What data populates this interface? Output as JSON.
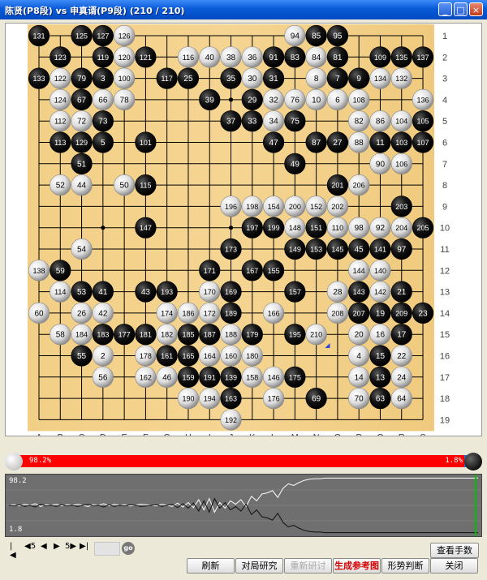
{
  "window": {
    "title": "陈贤(P8段) vs 申真谞(P9段) (210 / 210)",
    "controls": [
      "minimize",
      "maximize",
      "close"
    ]
  },
  "board": {
    "size": 19,
    "col_labels": [
      "A",
      "B",
      "C",
      "D",
      "E",
      "F",
      "G",
      "H",
      "I",
      "J",
      "K",
      "L",
      "M",
      "N",
      "O",
      "P",
      "Q",
      "R",
      "S"
    ],
    "row_labels": [
      "1",
      "2",
      "3",
      "4",
      "5",
      "6",
      "7",
      "8",
      "9",
      "10",
      "11",
      "12",
      "13",
      "14",
      "15",
      "16",
      "17",
      "18",
      "19"
    ],
    "last_move": 210,
    "stones": [
      {
        "n": 131,
        "c": "B",
        "col": "A",
        "row": 1
      },
      {
        "n": 125,
        "c": "B",
        "col": "C",
        "row": 1
      },
      {
        "n": 127,
        "c": "B",
        "col": "D",
        "row": 1
      },
      {
        "n": 126,
        "c": "W",
        "col": "E",
        "row": 1
      },
      {
        "n": 94,
        "c": "W",
        "col": "M",
        "row": 1
      },
      {
        "n": 85,
        "c": "B",
        "col": "N",
        "row": 1
      },
      {
        "n": 95,
        "c": "B",
        "col": "O",
        "row": 1
      },
      {
        "n": 123,
        "c": "B",
        "col": "B",
        "row": 2
      },
      {
        "n": 119,
        "c": "B",
        "col": "D",
        "row": 2
      },
      {
        "n": 120,
        "c": "W",
        "col": "E",
        "row": 2
      },
      {
        "n": 121,
        "c": "B",
        "col": "F",
        "row": 2
      },
      {
        "n": 116,
        "c": "W",
        "col": "H",
        "row": 2
      },
      {
        "n": 40,
        "c": "W",
        "col": "I",
        "row": 2
      },
      {
        "n": 38,
        "c": "W",
        "col": "J",
        "row": 2
      },
      {
        "n": 36,
        "c": "W",
        "col": "K",
        "row": 2
      },
      {
        "n": 91,
        "c": "B",
        "col": "L",
        "row": 2
      },
      {
        "n": 83,
        "c": "B",
        "col": "M",
        "row": 2
      },
      {
        "n": 84,
        "c": "W",
        "col": "N",
        "row": 2
      },
      {
        "n": 81,
        "c": "B",
        "col": "O",
        "row": 2
      },
      {
        "n": 109,
        "c": "B",
        "col": "Q",
        "row": 2
      },
      {
        "n": 135,
        "c": "B",
        "col": "R",
        "row": 2
      },
      {
        "n": 137,
        "c": "B",
        "col": "S",
        "row": 2
      },
      {
        "n": 133,
        "c": "B",
        "col": "A",
        "row": 3
      },
      {
        "n": 122,
        "c": "W",
        "col": "B",
        "row": 3
      },
      {
        "n": 79,
        "c": "B",
        "col": "C",
        "row": 3
      },
      {
        "n": 3,
        "c": "B",
        "col": "D",
        "row": 3
      },
      {
        "n": 100,
        "c": "W",
        "col": "E",
        "row": 3
      },
      {
        "n": 117,
        "c": "B",
        "col": "G",
        "row": 3
      },
      {
        "n": 25,
        "c": "B",
        "col": "H",
        "row": 3
      },
      {
        "n": 35,
        "c": "B",
        "col": "J",
        "row": 3
      },
      {
        "n": 30,
        "c": "W",
        "col": "K",
        "row": 3
      },
      {
        "n": 31,
        "c": "B",
        "col": "L",
        "row": 3
      },
      {
        "n": 8,
        "c": "W",
        "col": "N",
        "row": 3
      },
      {
        "n": 7,
        "c": "B",
        "col": "O",
        "row": 3
      },
      {
        "n": 9,
        "c": "B",
        "col": "P",
        "row": 3
      },
      {
        "n": 134,
        "c": "W",
        "col": "Q",
        "row": 3
      },
      {
        "n": 132,
        "c": "W",
        "col": "R",
        "row": 3
      },
      {
        "n": 124,
        "c": "W",
        "col": "B",
        "row": 4
      },
      {
        "n": 67,
        "c": "B",
        "col": "C",
        "row": 4
      },
      {
        "n": 66,
        "c": "W",
        "col": "D",
        "row": 4
      },
      {
        "n": 78,
        "c": "W",
        "col": "E",
        "row": 4
      },
      {
        "n": 39,
        "c": "B",
        "col": "I",
        "row": 4
      },
      {
        "n": 29,
        "c": "B",
        "col": "K",
        "row": 4
      },
      {
        "n": 32,
        "c": "W",
        "col": "L",
        "row": 4
      },
      {
        "n": 76,
        "c": "W",
        "col": "M",
        "row": 4
      },
      {
        "n": 10,
        "c": "W",
        "col": "N",
        "row": 4
      },
      {
        "n": 6,
        "c": "W",
        "col": "O",
        "row": 4
      },
      {
        "n": 108,
        "c": "W",
        "col": "P",
        "row": 4
      },
      {
        "n": 136,
        "c": "W",
        "col": "S",
        "row": 4
      },
      {
        "n": 112,
        "c": "W",
        "col": "B",
        "row": 5
      },
      {
        "n": 72,
        "c": "W",
        "col": "C",
        "row": 5
      },
      {
        "n": 73,
        "c": "B",
        "col": "D",
        "row": 5
      },
      {
        "n": 37,
        "c": "B",
        "col": "J",
        "row": 5
      },
      {
        "n": 33,
        "c": "B",
        "col": "K",
        "row": 5
      },
      {
        "n": 34,
        "c": "W",
        "col": "L",
        "row": 5
      },
      {
        "n": 75,
        "c": "B",
        "col": "M",
        "row": 5
      },
      {
        "n": 82,
        "c": "W",
        "col": "P",
        "row": 5
      },
      {
        "n": 86,
        "c": "W",
        "col": "Q",
        "row": 5
      },
      {
        "n": 104,
        "c": "W",
        "col": "R",
        "row": 5
      },
      {
        "n": 105,
        "c": "B",
        "col": "S",
        "row": 5
      },
      {
        "n": 113,
        "c": "B",
        "col": "B",
        "row": 6
      },
      {
        "n": 129,
        "c": "B",
        "col": "C",
        "row": 6
      },
      {
        "n": 5,
        "c": "B",
        "col": "D",
        "row": 6
      },
      {
        "n": 101,
        "c": "B",
        "col": "F",
        "row": 6
      },
      {
        "n": 47,
        "c": "B",
        "col": "L",
        "row": 6
      },
      {
        "n": 87,
        "c": "B",
        "col": "N",
        "row": 6
      },
      {
        "n": 27,
        "c": "B",
        "col": "O",
        "row": 6
      },
      {
        "n": 88,
        "c": "W",
        "col": "P",
        "row": 6
      },
      {
        "n": 11,
        "c": "B",
        "col": "Q",
        "row": 6
      },
      {
        "n": 103,
        "c": "B",
        "col": "R",
        "row": 6
      },
      {
        "n": 107,
        "c": "B",
        "col": "S",
        "row": 6
      },
      {
        "n": 51,
        "c": "B",
        "col": "C",
        "row": 7
      },
      {
        "n": 49,
        "c": "B",
        "col": "M",
        "row": 7
      },
      {
        "n": 90,
        "c": "W",
        "col": "Q",
        "row": 7
      },
      {
        "n": 106,
        "c": "W",
        "col": "R",
        "row": 7
      },
      {
        "n": 52,
        "c": "W",
        "col": "B",
        "row": 8
      },
      {
        "n": 44,
        "c": "W",
        "col": "C",
        "row": 8
      },
      {
        "n": 50,
        "c": "W",
        "col": "E",
        "row": 8
      },
      {
        "n": 115,
        "c": "B",
        "col": "F",
        "row": 8
      },
      {
        "n": 201,
        "c": "B",
        "col": "O",
        "row": 8
      },
      {
        "n": 206,
        "c": "W",
        "col": "P",
        "row": 8
      },
      {
        "n": 196,
        "c": "W",
        "col": "J",
        "row": 9
      },
      {
        "n": 198,
        "c": "W",
        "col": "K",
        "row": 9
      },
      {
        "n": 154,
        "c": "W",
        "col": "L",
        "row": 9
      },
      {
        "n": 200,
        "c": "W",
        "col": "M",
        "row": 9
      },
      {
        "n": 152,
        "c": "W",
        "col": "N",
        "row": 9
      },
      {
        "n": 202,
        "c": "W",
        "col": "O",
        "row": 9
      },
      {
        "n": 203,
        "c": "B",
        "col": "R",
        "row": 9
      },
      {
        "n": 147,
        "c": "B",
        "col": "F",
        "row": 10
      },
      {
        "n": 197,
        "c": "B",
        "col": "K",
        "row": 10
      },
      {
        "n": 199,
        "c": "B",
        "col": "L",
        "row": 10
      },
      {
        "n": 148,
        "c": "W",
        "col": "M",
        "row": 10
      },
      {
        "n": 151,
        "c": "B",
        "col": "N",
        "row": 10
      },
      {
        "n": 110,
        "c": "W",
        "col": "O",
        "row": 10
      },
      {
        "n": 98,
        "c": "W",
        "col": "P",
        "row": 10
      },
      {
        "n": 92,
        "c": "W",
        "col": "Q",
        "row": 10
      },
      {
        "n": 204,
        "c": "W",
        "col": "R",
        "row": 10
      },
      {
        "n": 205,
        "c": "B",
        "col": "S",
        "row": 10
      },
      {
        "n": 54,
        "c": "W",
        "col": "C",
        "row": 11
      },
      {
        "n": 173,
        "c": "B",
        "col": "J",
        "row": 11
      },
      {
        "n": 149,
        "c": "B",
        "col": "M",
        "row": 11
      },
      {
        "n": 153,
        "c": "B",
        "col": "N",
        "row": 11
      },
      {
        "n": 145,
        "c": "B",
        "col": "O",
        "row": 11
      },
      {
        "n": 45,
        "c": "B",
        "col": "P",
        "row": 11
      },
      {
        "n": 141,
        "c": "B",
        "col": "Q",
        "row": 11
      },
      {
        "n": 97,
        "c": "B",
        "col": "R",
        "row": 11
      },
      {
        "n": 138,
        "c": "W",
        "col": "A",
        "row": 12
      },
      {
        "n": 59,
        "c": "B",
        "col": "B",
        "row": 12
      },
      {
        "n": 171,
        "c": "B",
        "col": "I",
        "row": 12
      },
      {
        "n": 167,
        "c": "B",
        "col": "K",
        "row": 12
      },
      {
        "n": 155,
        "c": "B",
        "col": "L",
        "row": 12
      },
      {
        "n": 144,
        "c": "W",
        "col": "P",
        "row": 12
      },
      {
        "n": 140,
        "c": "W",
        "col": "Q",
        "row": 12
      },
      {
        "n": 114,
        "c": "W",
        "col": "B",
        "row": 13
      },
      {
        "n": 53,
        "c": "B",
        "col": "C",
        "row": 13
      },
      {
        "n": 41,
        "c": "B",
        "col": "D",
        "row": 13
      },
      {
        "n": 43,
        "c": "B",
        "col": "F",
        "row": 13
      },
      {
        "n": 193,
        "c": "B",
        "col": "G",
        "row": 13
      },
      {
        "n": 170,
        "c": "W",
        "col": "I",
        "row": 13
      },
      {
        "n": 169,
        "c": "B",
        "col": "J",
        "row": 13
      },
      {
        "n": 157,
        "c": "B",
        "col": "M",
        "row": 13
      },
      {
        "n": 28,
        "c": "W",
        "col": "O",
        "row": 13
      },
      {
        "n": 143,
        "c": "B",
        "col": "P",
        "row": 13
      },
      {
        "n": 142,
        "c": "W",
        "col": "Q",
        "row": 13
      },
      {
        "n": 21,
        "c": "B",
        "col": "R",
        "row": 13
      },
      {
        "n": 60,
        "c": "W",
        "col": "A",
        "row": 14
      },
      {
        "n": 26,
        "c": "W",
        "col": "C",
        "row": 14
      },
      {
        "n": 42,
        "c": "W",
        "col": "D",
        "row": 14
      },
      {
        "n": 174,
        "c": "W",
        "col": "G",
        "row": 14
      },
      {
        "n": 186,
        "c": "W",
        "col": "H",
        "row": 14
      },
      {
        "n": 172,
        "c": "W",
        "col": "I",
        "row": 14
      },
      {
        "n": 189,
        "c": "B",
        "col": "J",
        "row": 14
      },
      {
        "n": 166,
        "c": "W",
        "col": "L",
        "row": 14
      },
      {
        "n": 208,
        "c": "W",
        "col": "O",
        "row": 14
      },
      {
        "n": 207,
        "c": "B",
        "col": "P",
        "row": 14
      },
      {
        "n": 19,
        "c": "B",
        "col": "Q",
        "row": 14
      },
      {
        "n": 209,
        "c": "B",
        "col": "R",
        "row": 14
      },
      {
        "n": 23,
        "c": "B",
        "col": "S",
        "row": 14
      },
      {
        "n": 58,
        "c": "W",
        "col": "B",
        "row": 15
      },
      {
        "n": 184,
        "c": "W",
        "col": "C",
        "row": 15
      },
      {
        "n": 183,
        "c": "B",
        "col": "D",
        "row": 15
      },
      {
        "n": 177,
        "c": "B",
        "col": "E",
        "row": 15
      },
      {
        "n": 181,
        "c": "B",
        "col": "F",
        "row": 15
      },
      {
        "n": 182,
        "c": "W",
        "col": "G",
        "row": 15
      },
      {
        "n": 185,
        "c": "B",
        "col": "H",
        "row": 15
      },
      {
        "n": 187,
        "c": "B",
        "col": "I",
        "row": 15
      },
      {
        "n": 188,
        "c": "W",
        "col": "J",
        "row": 15
      },
      {
        "n": 179,
        "c": "B",
        "col": "K",
        "row": 15
      },
      {
        "n": 195,
        "c": "B",
        "col": "M",
        "row": 15
      },
      {
        "n": 210,
        "c": "W",
        "col": "N",
        "row": 15
      },
      {
        "n": 20,
        "c": "W",
        "col": "P",
        "row": 15
      },
      {
        "n": 16,
        "c": "W",
        "col": "Q",
        "row": 15
      },
      {
        "n": 17,
        "c": "B",
        "col": "R",
        "row": 15
      },
      {
        "n": 55,
        "c": "B",
        "col": "C",
        "row": 16
      },
      {
        "n": 2,
        "c": "W",
        "col": "D",
        "row": 16
      },
      {
        "n": 178,
        "c": "W",
        "col": "F",
        "row": 16
      },
      {
        "n": 161,
        "c": "B",
        "col": "G",
        "row": 16
      },
      {
        "n": 165,
        "c": "B",
        "col": "H",
        "row": 16
      },
      {
        "n": 164,
        "c": "W",
        "col": "I",
        "row": 16
      },
      {
        "n": 160,
        "c": "W",
        "col": "J",
        "row": 16
      },
      {
        "n": 180,
        "c": "W",
        "col": "K",
        "row": 16
      },
      {
        "n": 4,
        "c": "W",
        "col": "P",
        "row": 16
      },
      {
        "n": 15,
        "c": "B",
        "col": "Q",
        "row": 16
      },
      {
        "n": 22,
        "c": "W",
        "col": "R",
        "row": 16
      },
      {
        "n": 56,
        "c": "W",
        "col": "D",
        "row": 17
      },
      {
        "n": 162,
        "c": "W",
        "col": "F",
        "row": 17
      },
      {
        "n": 46,
        "c": "W",
        "col": "G",
        "row": 17
      },
      {
        "n": 159,
        "c": "B",
        "col": "H",
        "row": 17
      },
      {
        "n": 191,
        "c": "B",
        "col": "I",
        "row": 17
      },
      {
        "n": 139,
        "c": "B",
        "col": "J",
        "row": 17
      },
      {
        "n": 158,
        "c": "W",
        "col": "K",
        "row": 17
      },
      {
        "n": 146,
        "c": "W",
        "col": "L",
        "row": 17
      },
      {
        "n": 175,
        "c": "B",
        "col": "M",
        "row": 17
      },
      {
        "n": 14,
        "c": "W",
        "col": "P",
        "row": 17
      },
      {
        "n": 13,
        "c": "B",
        "col": "Q",
        "row": 17
      },
      {
        "n": 24,
        "c": "W",
        "col": "R",
        "row": 17
      },
      {
        "n": 190,
        "c": "W",
        "col": "H",
        "row": 18
      },
      {
        "n": 194,
        "c": "W",
        "col": "I",
        "row": 18
      },
      {
        "n": 163,
        "c": "B",
        "col": "J",
        "row": 18
      },
      {
        "n": 176,
        "c": "W",
        "col": "L",
        "row": 18
      },
      {
        "n": 69,
        "c": "B",
        "col": "N",
        "row": 18
      },
      {
        "n": 70,
        "c": "W",
        "col": "P",
        "row": 18
      },
      {
        "n": 63,
        "c": "B",
        "col": "Q",
        "row": 18
      },
      {
        "n": 64,
        "c": "W",
        "col": "R",
        "row": 18
      },
      {
        "n": 192,
        "c": "W",
        "col": "J",
        "row": 19
      }
    ]
  },
  "winrate": {
    "white_label": "98.2%",
    "black_label": "1.8%",
    "white_value": 98.2,
    "black_value": 1.8,
    "white_color": "#ff0000",
    "black_color": "#1f6fe0"
  },
  "graph": {
    "top_label": "98.2",
    "bottom_label": "1.8",
    "white_curve": [
      50,
      51,
      49,
      52,
      50,
      53,
      48,
      51,
      50,
      52,
      49,
      51,
      50,
      52,
      50,
      48,
      51,
      50,
      53,
      49,
      52,
      50,
      51,
      49,
      50,
      52,
      51,
      50,
      49,
      52,
      50,
      48,
      54,
      47,
      55,
      46,
      60,
      42,
      62,
      38,
      55,
      45,
      58,
      52,
      60,
      48,
      66,
      58,
      70,
      72,
      76,
      64,
      80,
      88,
      85,
      90,
      94,
      96,
      97,
      97,
      98,
      98,
      98,
      98,
      98,
      98,
      98,
      98,
      98,
      98,
      98,
      98,
      98,
      98,
      98,
      98,
      98,
      98,
      98,
      98,
      98,
      98,
      98,
      98,
      98,
      98,
      98,
      98,
      98,
      98.2
    ],
    "marker_color": "#00c000"
  },
  "nav": {
    "first": "|◀",
    "back5": "◀5",
    "back": "◀",
    "forward": "▶",
    "forward5": "5▶",
    "last": "▶|",
    "go": "go",
    "move_field": ""
  },
  "buttons": {
    "view_moves": "查看手数",
    "refresh": "刷新",
    "study": "对局研究",
    "restudy": "重新研讨",
    "reference": "生成参考图",
    "judge": "形势判断",
    "close": "关闭"
  }
}
